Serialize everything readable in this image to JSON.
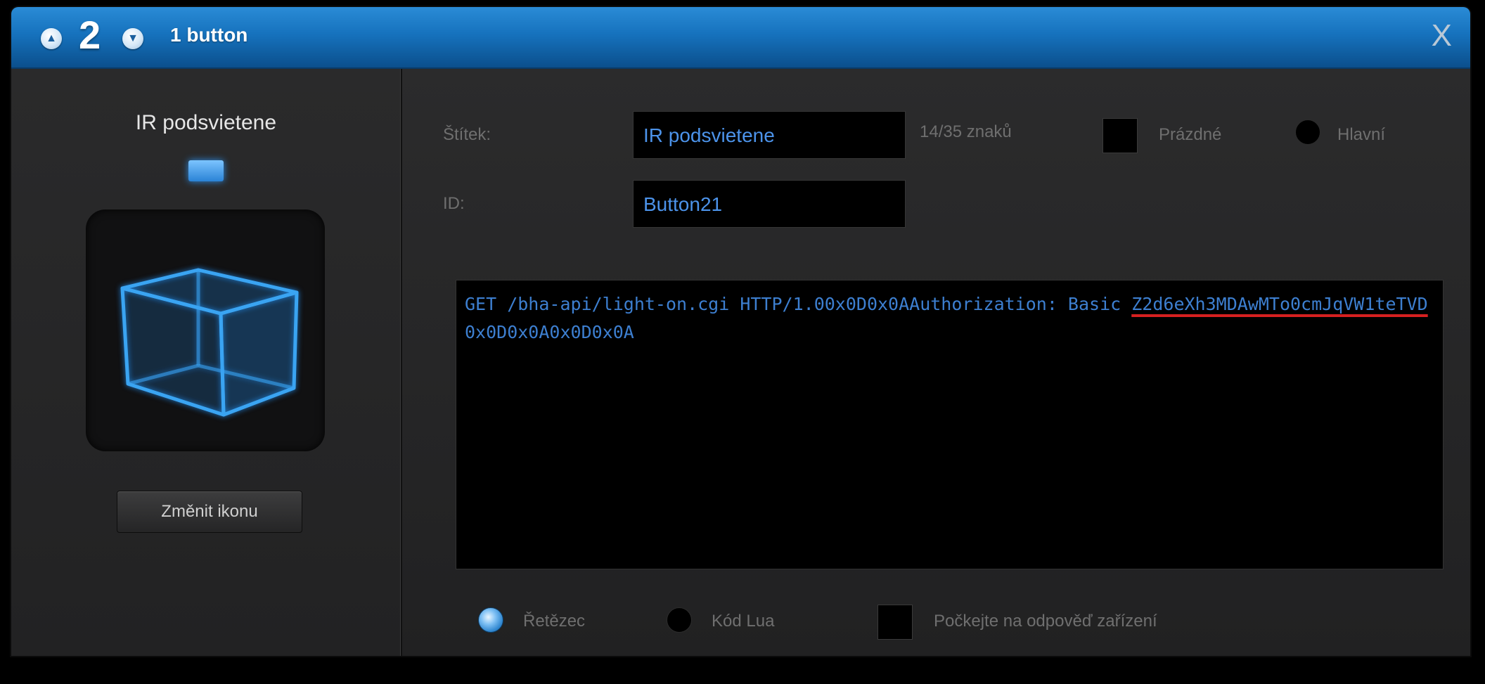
{
  "titlebar": {
    "number": "2",
    "title": "1 button",
    "close": "X"
  },
  "left": {
    "label": "IR podsvietene",
    "change_icon_button": "Změnit ikonu"
  },
  "form": {
    "label_field": {
      "label": "Štítek:",
      "value": "IR podsvietene",
      "char_count": "14/35 znaků"
    },
    "id_field": {
      "label": "ID:",
      "value": "Button21"
    },
    "empty_checkbox_label": "Prázdné",
    "main_radio_label": "Hlavní"
  },
  "code": {
    "line1": "GET /bha-api/light-on.cgi HTTP/1.00x0D0x0AAuthorization: Basic ",
    "underlined": "Z2d6eXh3MDAwMTo0cmJqVW1teTVD",
    "rest": "0x0D0x0A0x0D0x0A"
  },
  "bottom": {
    "string_radio": "Řetězec",
    "lua_radio": "Kód Lua",
    "wait_checkbox": "Počkejte na odpověď zařízení"
  },
  "colors": {
    "accent": "#1672bd",
    "code_text": "#3d7fd0",
    "underline": "#d62020"
  }
}
